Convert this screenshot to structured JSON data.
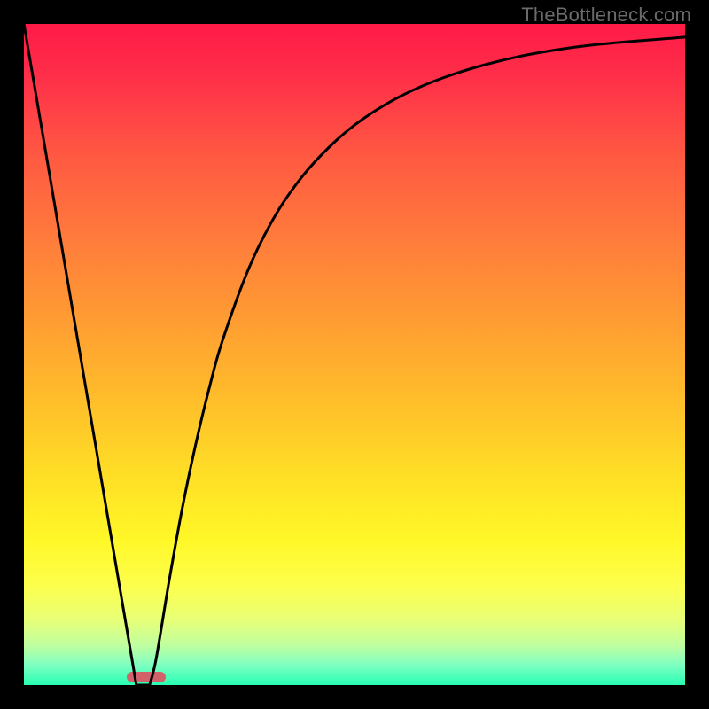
{
  "attribution": "TheBottleneck.com",
  "colors": {
    "background": "#000000",
    "gradient_top": "#ff1a47",
    "gradient_bottom": "#26ffb2",
    "curve": "#000000",
    "bottleneck_marker": "#d1626a",
    "attribution_text": "#6b6b6b"
  },
  "chart_data": {
    "type": "line",
    "title": "",
    "xlabel": "",
    "ylabel": "",
    "xlim": [
      0,
      100
    ],
    "ylim": [
      0,
      100
    ],
    "x": [
      0,
      2,
      4,
      6,
      8,
      10,
      12,
      14,
      16,
      17,
      18,
      19,
      20,
      22,
      24,
      26,
      28,
      30,
      34,
      38,
      42,
      46,
      50,
      55,
      60,
      65,
      70,
      75,
      80,
      85,
      90,
      95,
      100
    ],
    "series": [
      {
        "name": "bottleneck-curve",
        "values": [
          100,
          88.2,
          76.5,
          64.7,
          52.9,
          41.2,
          29.4,
          17.6,
          5.9,
          0,
          0,
          0,
          4.0,
          16.0,
          27.0,
          36.5,
          44.8,
          52.0,
          63.0,
          71.0,
          76.8,
          81.2,
          84.7,
          88.0,
          90.5,
          92.4,
          93.9,
          95.1,
          96.0,
          96.7,
          97.2,
          97.6,
          98.0
        ]
      }
    ],
    "bottleneck_region": {
      "x_start": 15.5,
      "x_end": 21.5
    },
    "background_gradient": {
      "orientation": "vertical",
      "stops": [
        {
          "pos": 0.0,
          "color": "#ff1a47"
        },
        {
          "pos": 0.2,
          "color": "#ff5942"
        },
        {
          "pos": 0.44,
          "color": "#ff9a33"
        },
        {
          "pos": 0.68,
          "color": "#ffde26"
        },
        {
          "pos": 0.85,
          "color": "#fdff4d"
        },
        {
          "pos": 0.94,
          "color": "#bfffa0"
        },
        {
          "pos": 1.0,
          "color": "#26ffb2"
        }
      ]
    }
  }
}
